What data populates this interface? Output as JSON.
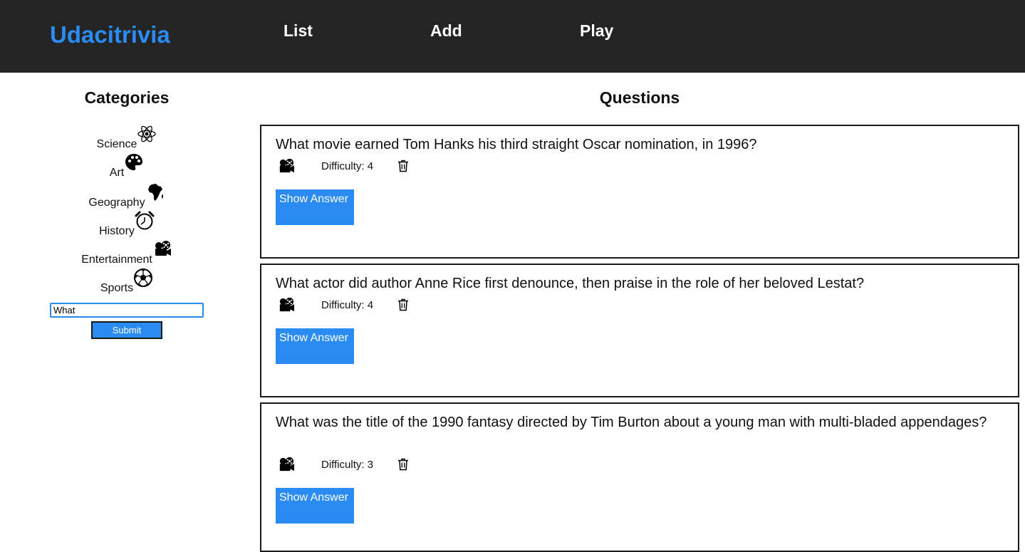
{
  "nav": {
    "brand": "Udacitrivia",
    "links": [
      "List",
      "Add",
      "Play"
    ]
  },
  "sidebar": {
    "title": "Categories",
    "categories": [
      {
        "label": "Science",
        "icon": "science-icon"
      },
      {
        "label": "Art",
        "icon": "art-icon"
      },
      {
        "label": "Geography",
        "icon": "geography-icon"
      },
      {
        "label": "History",
        "icon": "history-icon"
      },
      {
        "label": "Entertainment",
        "icon": "entertainment-icon"
      },
      {
        "label": "Sports",
        "icon": "sports-icon"
      }
    ],
    "search_value": "What",
    "submit_label": "Submit"
  },
  "main": {
    "title": "Questions",
    "questions": [
      {
        "text": "What movie earned Tom Hanks his third straight Oscar nomination, in 1996?",
        "category_icon": "entertainment-icon",
        "difficulty": "Difficulty: 4",
        "show_answer": "Show Answer"
      },
      {
        "text": "What actor did author Anne Rice first denounce, then praise in the role of her beloved Lestat?",
        "category_icon": "entertainment-icon",
        "difficulty": "Difficulty: 4",
        "show_answer": "Show Answer"
      },
      {
        "text": "What was the title of the 1990 fantasy directed by Tim Burton about a young man with multi-bladed appendages?",
        "category_icon": "entertainment-icon",
        "difficulty": "Difficulty: 3",
        "show_answer": "Show Answer"
      }
    ]
  },
  "colors": {
    "accent": "#2a8bf2",
    "navbar": "#242424"
  }
}
